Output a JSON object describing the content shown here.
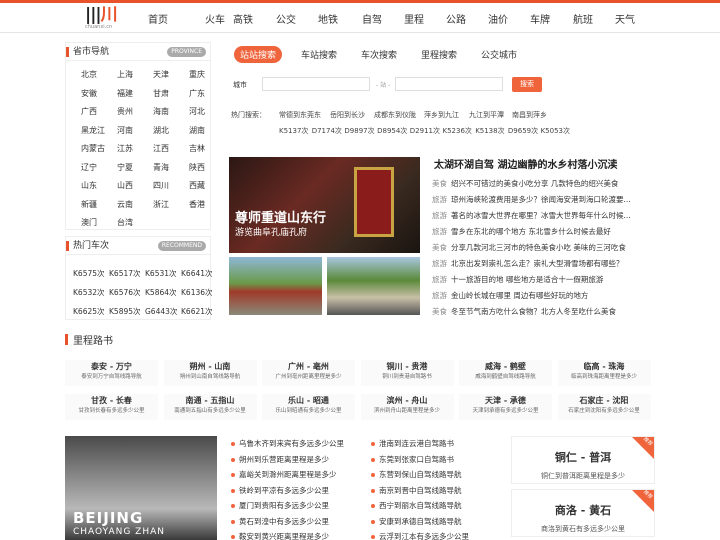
{
  "logo": {
    "text": "chuanxi.cn"
  },
  "nav": [
    "首页",
    "火车",
    "高铁",
    "公交",
    "地铁",
    "自驾",
    "里程",
    "公路",
    "油价",
    "车牌",
    "航班",
    "天气"
  ],
  "province": {
    "title": "省市导航",
    "badge": "PROVINCE",
    "items": [
      "北京",
      "上海",
      "天津",
      "重庆",
      "安徽",
      "福建",
      "甘肃",
      "广东",
      "广西",
      "贵州",
      "海南",
      "河北",
      "黑龙江",
      "河南",
      "湖北",
      "湖南",
      "内蒙古",
      "江苏",
      "江西",
      "吉林",
      "辽宁",
      "宁夏",
      "青海",
      "陕西",
      "山东",
      "山西",
      "四川",
      "西藏",
      "新疆",
      "云南",
      "浙江",
      "香港",
      "澳门",
      "台湾"
    ]
  },
  "hottrain": {
    "title": "热门车次",
    "badge": "RECOMMEND",
    "items": [
      "K6575次",
      "K6517次",
      "K6531次",
      "K6641次",
      "K6532次",
      "K6576次",
      "K5864次",
      "K6136次",
      "K6625次",
      "K5895次",
      "G6443次",
      "K6621次"
    ]
  },
  "search": {
    "tabs": [
      "站站搜索",
      "车站搜索",
      "车次搜索",
      "里程搜索",
      "公交城市"
    ],
    "city_label": "城市",
    "sep": "- 站 -",
    "button": "搜索",
    "hot_label": "热门搜索：",
    "hot_row1": [
      "常德到东莞东",
      "岳阳到长沙",
      "成都东到仪陇",
      "萍乡到九江",
      "九江到平潭",
      "南昌到萍乡"
    ],
    "hot_row2": [
      "K5137次",
      "D7174次",
      "D9897次",
      "D8954次",
      "D2911次",
      "K5236次",
      "K5138次",
      "D9659次",
      "K5053次"
    ]
  },
  "feature": {
    "caption1": "尊师重道山东行",
    "caption2": "游览曲阜孔庙孔府",
    "plaque": "弘道門"
  },
  "headline": "太湖环湖自驾 湖边幽静的水乡村落小沉渎",
  "news": [
    {
      "cat": "美食",
      "text": "绍兴不可错过的美食小吃分享 几款特色的绍兴美食"
    },
    {
      "cat": "旅游",
      "text": "琼州海峡轮渡费用是多少？徐闻海安港到海口轮渡要..."
    },
    {
      "cat": "旅游",
      "text": "著名的冰雪大世界在哪里？冰雪大世界每年什么时候..."
    },
    {
      "cat": "旅游",
      "text": "雪乡在东北的哪个地方 东北雪乡什么时候去最好"
    },
    {
      "cat": "美食",
      "text": "分享几款河北三河市的特色美食小吃 美味的三河吃食"
    },
    {
      "cat": "旅游",
      "text": "北京出发到崇礼怎么走？崇礼大型滑雪场都有哪些？"
    },
    {
      "cat": "旅游",
      "text": "十一旅游目的地 哪些地方是适合十一假期旅游"
    },
    {
      "cat": "旅游",
      "text": "金山岭长城在哪里 周边有哪些好玩的地方"
    },
    {
      "cat": "美食",
      "text": "冬至节气南方吃什么食物？北方人冬至吃什么美食"
    }
  ],
  "km": {
    "title": "里程路书",
    "cards": [
      {
        "t": "泰安 - 万宁",
        "d": "泰安到万宁自驾线路导航"
      },
      {
        "t": "朔州 - 山南",
        "d": "朔州到山南自驾线路导航"
      },
      {
        "t": "广州 - 亳州",
        "d": "广州到亳州距离里程是多少"
      },
      {
        "t": "铜川 - 贵港",
        "d": "铜川到贵港自驾路书"
      },
      {
        "t": "威海 - 鹤壁",
        "d": "威海到鹤壁自驾线路导航"
      },
      {
        "t": "临高 - 珠海",
        "d": "临高到珠海距离里程是多少"
      },
      {
        "t": "甘孜 - 长春",
        "d": "甘孜到长春有多远多少公里"
      },
      {
        "t": "南通 - 五指山",
        "d": "南通到五指山有多远多少公里"
      },
      {
        "t": "乐山 - 昭通",
        "d": "乐山到昭通有多远多少公里"
      },
      {
        "t": "滨州 - 舟山",
        "d": "滨州到舟山距离里程是多少"
      },
      {
        "t": "天津 - 承德",
        "d": "天津到承德有多远多少公里"
      },
      {
        "t": "石家庄 - 沈阳",
        "d": "石家庄到沈阳有多远多少公里"
      }
    ]
  },
  "bottom": {
    "img1": "BEIJING",
    "img2": "CHAOYANG ZHAN",
    "col1": [
      "乌鲁木齐到来宾有多远多少公里",
      "朔州到乐营距离里程是多少",
      "嘉峪关到滁州距离里程是多少",
      "铁岭到平凉有多远多少公里",
      "厦门到贵阳有多远多少公里",
      "黄石到湟中有多远多少公里",
      "鞍安到黄兴距离里程是多少"
    ],
    "col2": [
      "淮南到连云港自驾路书",
      "东莞到张家口自驾路书",
      "东营到保山自驾线路导航",
      "南京到晋中自驾线路导航",
      "西宁到丽水自驾线路导航",
      "安康到承德自驾线路导航",
      "云浮到江本有多远多少公里"
    ],
    "cards": [
      {
        "t": "铜仁 - 普洱",
        "d": "铜仁到普洱距离里程是多少",
        "tag": "推荐"
      },
      {
        "t": "商洛 - 黄石",
        "d": "商洛到黄石有多远多少公里",
        "tag": "推荐"
      }
    ]
  }
}
